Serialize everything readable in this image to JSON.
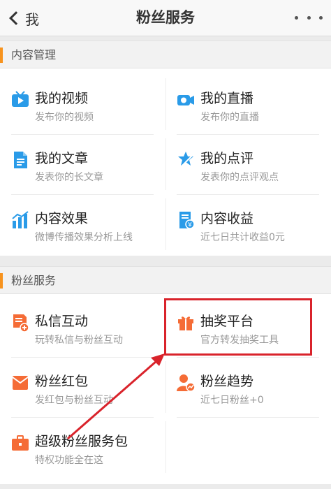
{
  "header": {
    "back_label": "我",
    "title": "粉丝服务"
  },
  "sections": {
    "content": {
      "title": "内容管理",
      "items": [
        {
          "name": "我的视频",
          "desc": "发布你的视频",
          "icon": "video-icon"
        },
        {
          "name": "我的直播",
          "desc": "发布你的直播",
          "icon": "camera-icon"
        },
        {
          "name": "我的文章",
          "desc": "发表你的长文章",
          "icon": "document-icon"
        },
        {
          "name": "我的点评",
          "desc": "发表你的点评观点",
          "icon": "pen-icon"
        },
        {
          "name": "内容效果",
          "desc": "微博传播效果分析上线",
          "icon": "bar-chart-icon"
        },
        {
          "name": "内容收益",
          "desc": "近七日共计收益0元",
          "icon": "income-icon"
        }
      ]
    },
    "fans": {
      "title": "粉丝服务",
      "items": [
        {
          "name": "私信互动",
          "desc": "玩转私信与粉丝互动",
          "icon": "message-icon"
        },
        {
          "name": "抽奖平台",
          "desc": "官方转发抽奖工具",
          "icon": "gift-icon"
        },
        {
          "name": "粉丝红包",
          "desc": "发红包与粉丝互动",
          "icon": "red-envelope-icon"
        },
        {
          "name": "粉丝趋势",
          "desc": "近七日粉丝+0",
          "icon": "fan-trend-icon"
        },
        {
          "name": "超级粉丝服务包",
          "desc": "特权功能全在这",
          "icon": "briefcase-icon"
        }
      ]
    }
  },
  "colors": {
    "blue_icon": "#2a9be8",
    "orange_icon": "#f56c36",
    "section_accent": "#f7931e",
    "annotation_red": "#d9232b"
  }
}
